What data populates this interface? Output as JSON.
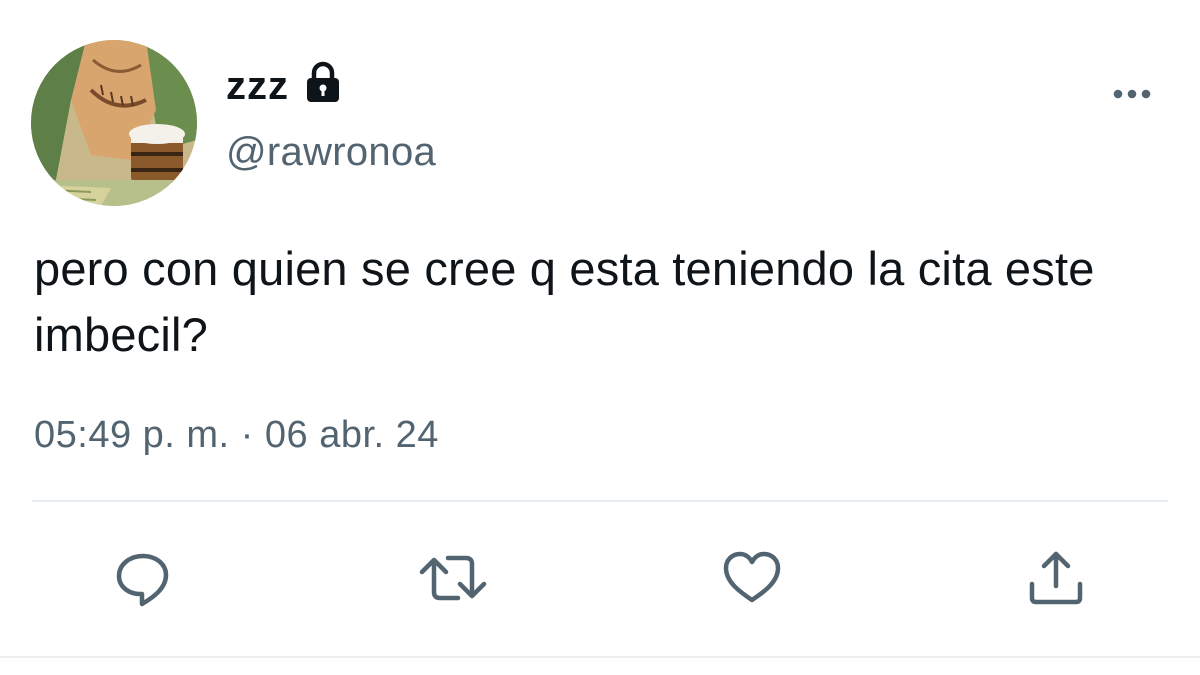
{
  "user": {
    "display_name": "zzz",
    "handle": "@rawronoa",
    "protected": true,
    "avatar": "avatar-illustration"
  },
  "tweet": {
    "text": "pero con quien se cree q esta teniendo la cita este imbecil?",
    "timestamp": "05:49 p. m. · 06 abr. 24"
  },
  "icons": {
    "lock": "lock-icon",
    "more": "more-horizontal-icon",
    "reply": "reply-icon",
    "retweet": "retweet-icon",
    "like": "heart-icon",
    "share": "share-icon"
  },
  "colors": {
    "text_primary": "#0f1419",
    "text_secondary": "#536471",
    "icon": "#536471",
    "divider": "#e6ecf0"
  }
}
